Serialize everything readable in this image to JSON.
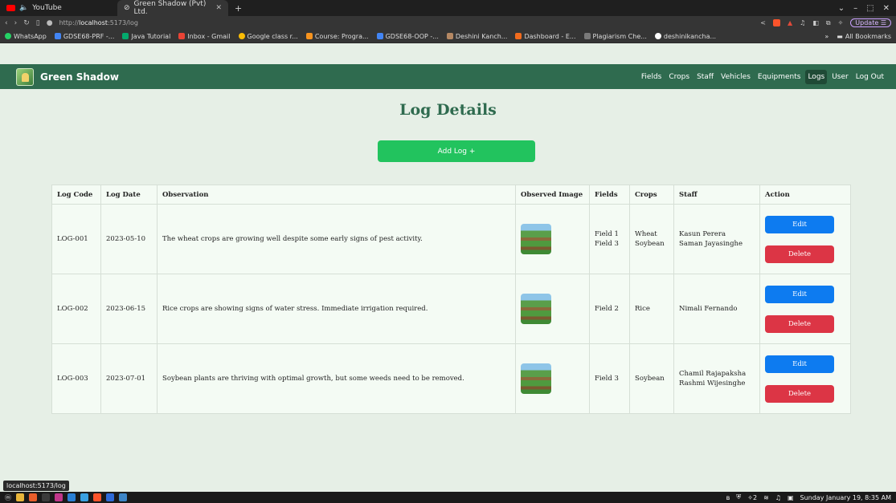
{
  "browser": {
    "tabs": [
      {
        "label": "YouTube"
      },
      {
        "label": "Green Shadow (Pvt) Ltd."
      }
    ],
    "new_tab": "+",
    "url_prefix": "http://",
    "url_host": "localhost",
    "url_path": ":5173/log",
    "update_label": "Update",
    "bookmarks": [
      "WhatsApp",
      "GDSE68-PRF -...",
      "Java Tutorial",
      "Inbox - Gmail",
      "Google class r...",
      "Course: Progra...",
      "GDSE68-OOP -...",
      "Deshini Kanch...",
      "Dashboard - E...",
      "Plagiarism Che...",
      "deshinikancha..."
    ],
    "all_bookmarks": "All Bookmarks",
    "more": "»"
  },
  "app": {
    "brand": "Green Shadow",
    "nav": [
      {
        "label": "Fields",
        "active": false
      },
      {
        "label": "Crops",
        "active": false
      },
      {
        "label": "Staff",
        "active": false
      },
      {
        "label": "Vehicles",
        "active": false
      },
      {
        "label": "Equipments",
        "active": false
      },
      {
        "label": "Logs",
        "active": true
      },
      {
        "label": "User",
        "active": false
      },
      {
        "label": "Log Out",
        "active": false
      }
    ]
  },
  "page": {
    "title": "Log Details",
    "add_button": "Add Log +"
  },
  "table": {
    "headers": [
      "Log Code",
      "Log Date",
      "Observation",
      "Observed Image",
      "Fields",
      "Crops",
      "Staff",
      "Action"
    ],
    "rows": [
      {
        "code": "LOG-001",
        "date": "2023-05-10",
        "observation": "The wheat crops are growing well despite some early signs of pest activity.",
        "fields": [
          "Field 1",
          "Field 3"
        ],
        "crops": [
          "Wheat",
          "Soybean"
        ],
        "staff": [
          "Kasun Perera",
          "Saman Jayasinghe"
        ]
      },
      {
        "code": "LOG-002",
        "date": "2023-06-15",
        "observation": "Rice crops are showing signs of water stress. Immediate irrigation required.",
        "fields": [
          "Field 2"
        ],
        "crops": [
          "Rice"
        ],
        "staff": [
          "Nimali Fernando"
        ]
      },
      {
        "code": "LOG-003",
        "date": "2023-07-01",
        "observation": "Soybean plants are thriving with optimal growth, but some weeds need to be removed.",
        "fields": [
          "Field 3"
        ],
        "crops": [
          "Soybean"
        ],
        "staff": [
          "Chamil Rajapaksha",
          "Rashmi Wijesinghe"
        ]
      }
    ],
    "edit_label": "Edit",
    "delete_label": "Delete"
  },
  "status_url": "localhost:5173/log",
  "taskbar": {
    "clock": "Sunday January 19, 8:35 AM",
    "notif_count": "2"
  }
}
